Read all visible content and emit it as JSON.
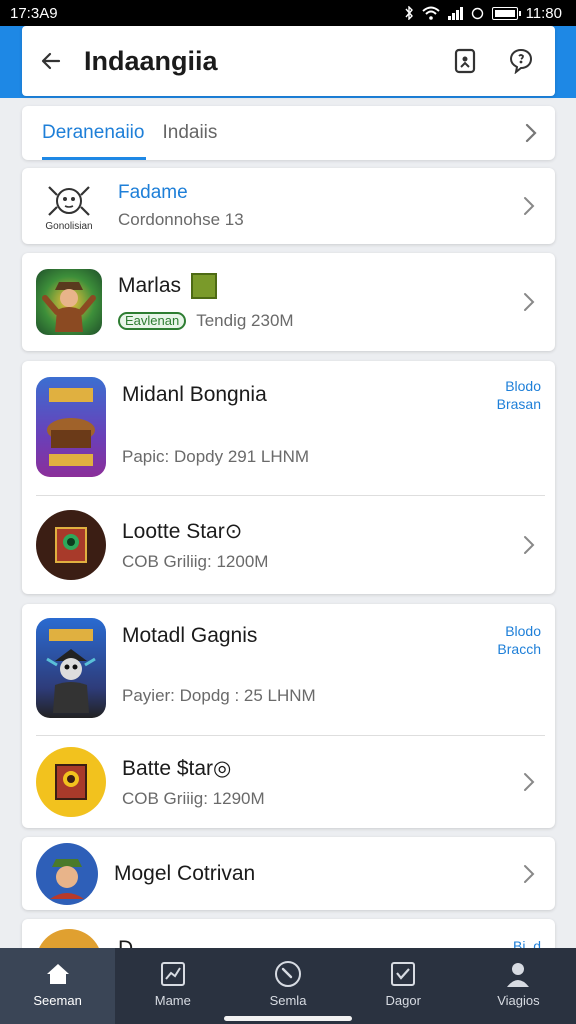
{
  "status_bar": {
    "time_left": "17:3A9",
    "time_right": "11:80"
  },
  "app_bar": {
    "title": "Indaangiia"
  },
  "tabs": [
    {
      "label": "Deranenaiio",
      "active": true
    },
    {
      "label": "Indaiis",
      "active": false
    }
  ],
  "items": [
    {
      "title": "Fadame",
      "subtitle": "Cordonnohse 13",
      "thumb_label": "Gonolisian",
      "title_color": "#1e7fd8"
    },
    {
      "title": "Marlas",
      "badge": "Eavlenan",
      "subtitle": "Tendig 230M"
    },
    {
      "title": "Midanl Bongnia",
      "subtitle": "Papic: Dopdy 291 LHNM",
      "side_link": [
        "Blodo",
        "Brasan"
      ]
    },
    {
      "title": "Lootte Star⊙",
      "subtitle": "COB Griliig: 1200M"
    },
    {
      "title": "Motadl Gagnis",
      "subtitle": "Payier: Dopdg : 25 LHNM",
      "side_link": [
        "Blodo",
        "Bracch"
      ]
    },
    {
      "title": "Batte $tar◎",
      "subtitle": "COB Griiig: 1290M"
    },
    {
      "title": "Mogel Cotrivan"
    },
    {
      "title": "D",
      "side_link": [
        "Bi..d"
      ]
    }
  ],
  "bottom_nav": [
    {
      "label": "Seeman",
      "icon": "home-icon",
      "active": true
    },
    {
      "label": "Mame",
      "icon": "chart-icon",
      "active": false
    },
    {
      "label": "Semla",
      "icon": "compass-icon",
      "active": false
    },
    {
      "label": "Dagor",
      "icon": "badge-check-icon",
      "active": false
    },
    {
      "label": "Viagios",
      "icon": "person-icon",
      "active": false
    }
  ],
  "colors": {
    "accent": "#1e88e5",
    "nav_bg": "#2a3240",
    "badge_green": "#2e7d32"
  }
}
